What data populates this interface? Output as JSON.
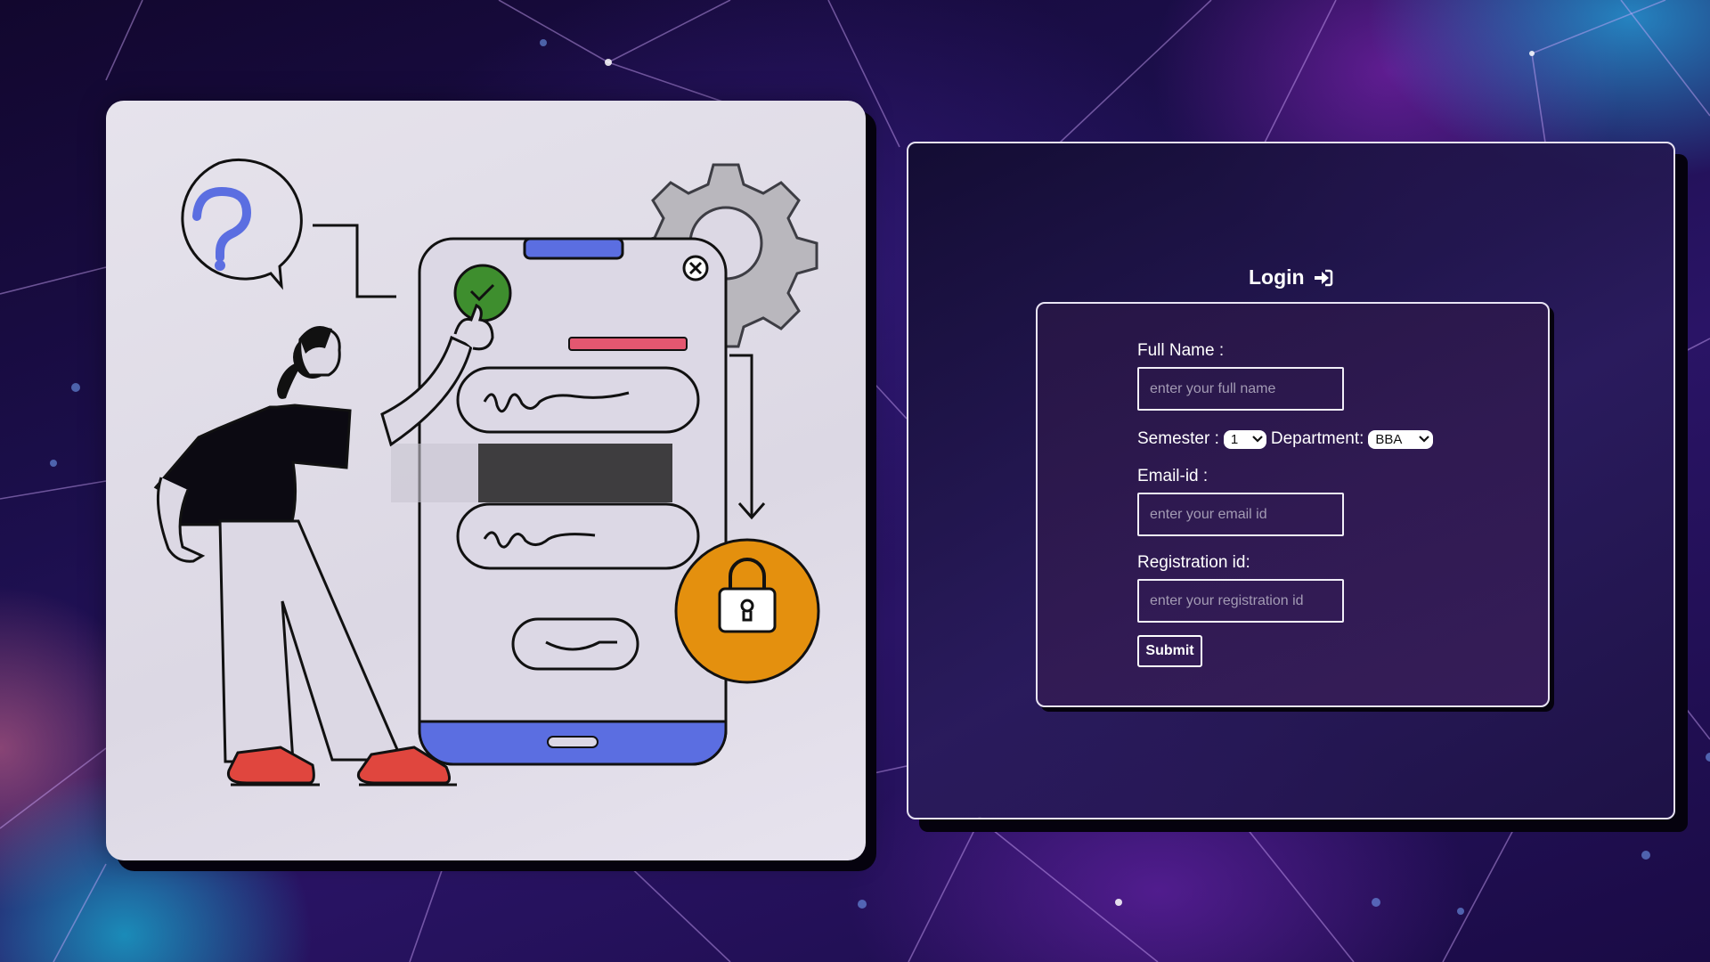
{
  "login": {
    "title": "Login",
    "title_icon": "login-arrow-icon",
    "fields": {
      "full_name_label": "Full Name :",
      "full_name_placeholder": "enter your full name",
      "semester_label": "Semester :",
      "semester_value": "1",
      "department_label": "Department:",
      "department_value": "BBA",
      "email_label": "Email-id :",
      "email_placeholder": "enter your email id",
      "registration_label": "Registration id:",
      "registration_placeholder": "enter your registration id"
    },
    "submit_label": "Submit"
  },
  "illustration": {
    "icons": [
      "question-bubble-icon",
      "gear-icon",
      "lock-icon",
      "checkmark-icon",
      "close-icon"
    ]
  },
  "colors": {
    "accent_blue": "#5b6ee1",
    "check_green": "#3e8e2e",
    "lock_orange": "#e4900e",
    "shoe_red": "#e0463e",
    "error_pink": "#e45770"
  }
}
